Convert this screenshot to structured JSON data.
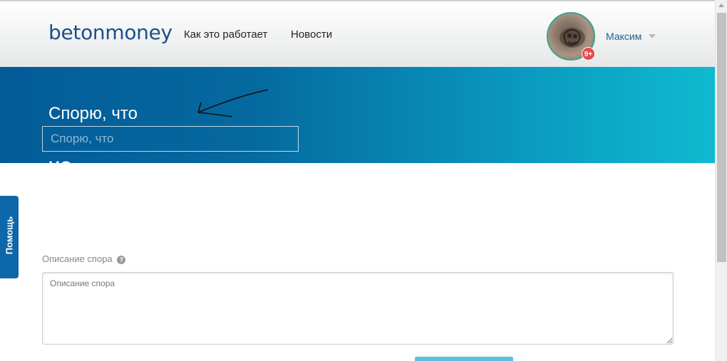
{
  "header": {
    "logo": "betonmoney",
    "nav": [
      {
        "label": "Как это работает"
      },
      {
        "label": "Новости"
      }
    ],
    "user": {
      "name": "Максим",
      "notifications_badge": "9+"
    }
  },
  "hero": {
    "title": "Спорю, что",
    "input_placeholder": "Спорю, что",
    "input_value": "",
    "next_label_partial": "НО"
  },
  "help_tab": {
    "label": "Помощь"
  },
  "description": {
    "label": "Описание спора",
    "help_icon_glyph": "?",
    "placeholder": "Описание спора",
    "value": ""
  },
  "colors": {
    "brand": "#1d4f8a",
    "hero_start": "#035b98",
    "hero_end": "#0fbad0",
    "help_tab": "#0d67a8",
    "badge": "#e64a4a",
    "submit": "#5cc0dd"
  },
  "icons": {
    "help_icon": "question-circle-icon",
    "caret": "caret-down-icon"
  }
}
